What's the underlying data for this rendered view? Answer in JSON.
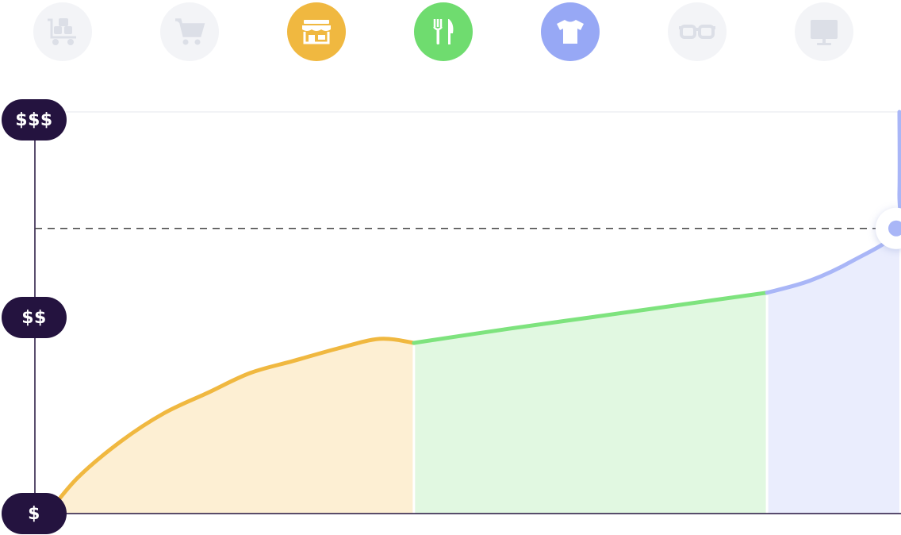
{
  "chart_data": {
    "type": "area",
    "title": "",
    "xlabel": "",
    "ylabel": "",
    "x_range": [
      0,
      100
    ],
    "y_range": [
      0,
      100
    ],
    "y_tick_labels": [
      {
        "value": 0,
        "label": "$"
      },
      {
        "value": 49,
        "label": "$$"
      },
      {
        "value": 100,
        "label": "$$$"
      }
    ],
    "grid": false,
    "legend": "none",
    "series": [
      {
        "color": "#f0b840",
        "fill": "#fdefd3",
        "x": [
          1.5,
          5,
          10,
          15,
          20,
          25,
          30,
          35,
          40,
          44
        ],
        "y": [
          0,
          9,
          18,
          25,
          30,
          35,
          38,
          41,
          43.5,
          42.5
        ]
      },
      {
        "color": "#7ee37e",
        "fill": "#e1f8e1",
        "x": [
          44,
          55,
          65,
          75,
          85
        ],
        "y": [
          42.5,
          46,
          49,
          52,
          55
        ]
      },
      {
        "color": "#a9b6f7",
        "fill": "#eaedfd",
        "x": [
          85,
          90,
          95,
          100,
          102.5,
          105
        ],
        "y": [
          55,
          58,
          63,
          70,
          80,
          100
        ]
      }
    ],
    "highlight": {
      "x": 100,
      "y": 71,
      "reference_line": "dashed-to-y-axis",
      "color": "#a9b6f7"
    },
    "segment_dividers_x": [
      44,
      85
    ]
  },
  "categories": [
    {
      "icon": "warehouse-cart-icon",
      "active": false,
      "color": "#f3f4f7"
    },
    {
      "icon": "shopping-cart-icon",
      "active": false,
      "color": "#f3f4f7"
    },
    {
      "icon": "storefront-icon",
      "active": true,
      "color": "#f0b840"
    },
    {
      "icon": "fork-knife-icon",
      "active": true,
      "color": "#6fdc6f"
    },
    {
      "icon": "tshirt-icon",
      "active": true,
      "color": "#97a8f5"
    },
    {
      "icon": "glasses-icon",
      "active": false,
      "color": "#f3f4f7"
    },
    {
      "icon": "monitor-icon",
      "active": false,
      "color": "#f3f4f7"
    }
  ]
}
